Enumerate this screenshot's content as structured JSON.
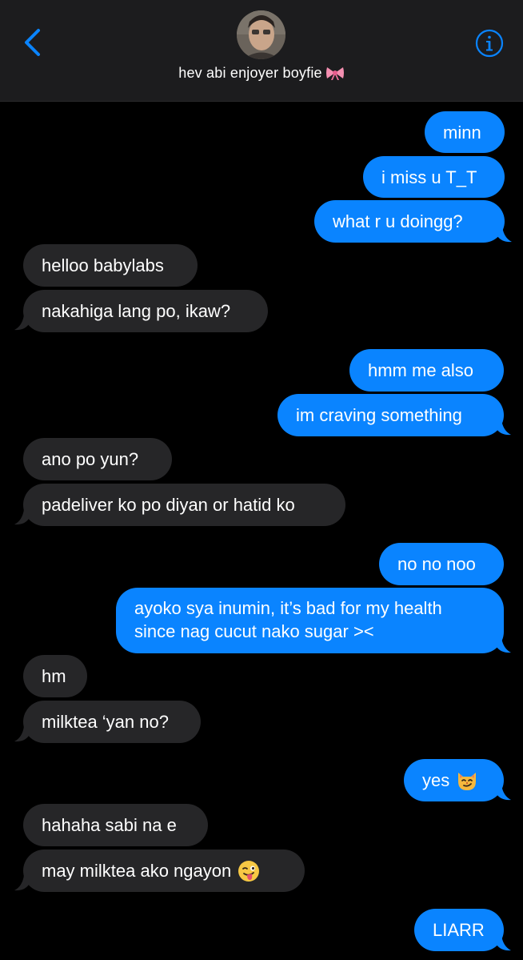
{
  "header": {
    "contact_name": "hev abi enjoyer boyfie",
    "name_emoji_icon": "ribbon-bow-icon",
    "back_icon": "chevron-left-icon",
    "info_icon": "info-icon"
  },
  "colors": {
    "sent_bubble": "#0a84ff",
    "received_bubble": "#262628",
    "header_bg": "#1c1c1e",
    "accent": "#0a84ff"
  },
  "messages": [
    {
      "from": "me",
      "text": "minn"
    },
    {
      "from": "me",
      "text": "i miss u T_T"
    },
    {
      "from": "me",
      "text": "what r u doingg?"
    },
    {
      "from": "them",
      "text": "helloo babylabs"
    },
    {
      "from": "them",
      "text": "nakahiga lang po, ikaw?"
    },
    {
      "from": "me",
      "text": "hmm me also"
    },
    {
      "from": "me",
      "text": "im craving something"
    },
    {
      "from": "them",
      "text": "ano po yun?"
    },
    {
      "from": "them",
      "text": "padeliver ko po diyan or hatid ko"
    },
    {
      "from": "me",
      "text": "no no noo"
    },
    {
      "from": "me",
      "text": "ayoko sya inumin, it’s bad for my health since nag cucut nako sugar ><"
    },
    {
      "from": "them",
      "text": "hm"
    },
    {
      "from": "them",
      "text": "milktea ‘yan no?"
    },
    {
      "from": "me",
      "text": "yes",
      "emoji": "smirk-cat-emoji"
    },
    {
      "from": "them",
      "text": "hahaha sabi na e"
    },
    {
      "from": "them",
      "text": "may milktea ako ngayon",
      "emoji": "winking-tongue-emoji"
    },
    {
      "from": "me",
      "text": "LIARR"
    }
  ]
}
